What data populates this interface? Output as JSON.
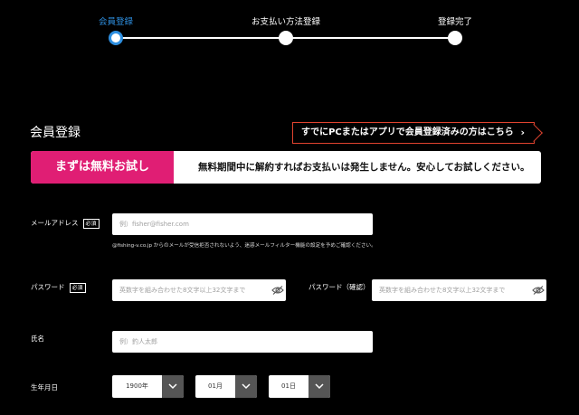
{
  "stepper": {
    "steps": [
      {
        "label": "会員登録",
        "active": true
      },
      {
        "label": "お支払い方法登録",
        "active": false
      },
      {
        "label": "登録完了",
        "active": false
      }
    ],
    "active_color": "#2e8fe0"
  },
  "section_title": "会員登録",
  "login_link": {
    "label": "すでにPCまたはアプリで会員登録済みの方はこちら",
    "chevron": "›"
  },
  "trial": {
    "badge": "まずは無料お試し",
    "message": "無料期間中に解約すればお支払いは発生しません。安心してお試しください。",
    "badge_color": "#e01e74"
  },
  "form": {
    "email": {
      "label": "メールアドレス",
      "required": "必須",
      "placeholder": "例）fisher@fisher.com",
      "note": "@fishing-v.co.jp からのメールが受信拒否されないよう、迷惑メールフィルター機能の設定を予めご確認ください。"
    },
    "password": {
      "label": "パスワード",
      "required": "必須",
      "placeholder": "英数字を組み合わせた8文字以上32文字まで"
    },
    "password_confirm": {
      "label": "パスワード（確認）",
      "placeholder": "英数字を組み合わせた8文字以上32文字まで"
    },
    "name": {
      "label": "氏名",
      "placeholder": "例）釣人太郎"
    },
    "birthdate": {
      "label": "生年月日",
      "year": "1900年",
      "month": "01月",
      "day": "01日"
    }
  }
}
